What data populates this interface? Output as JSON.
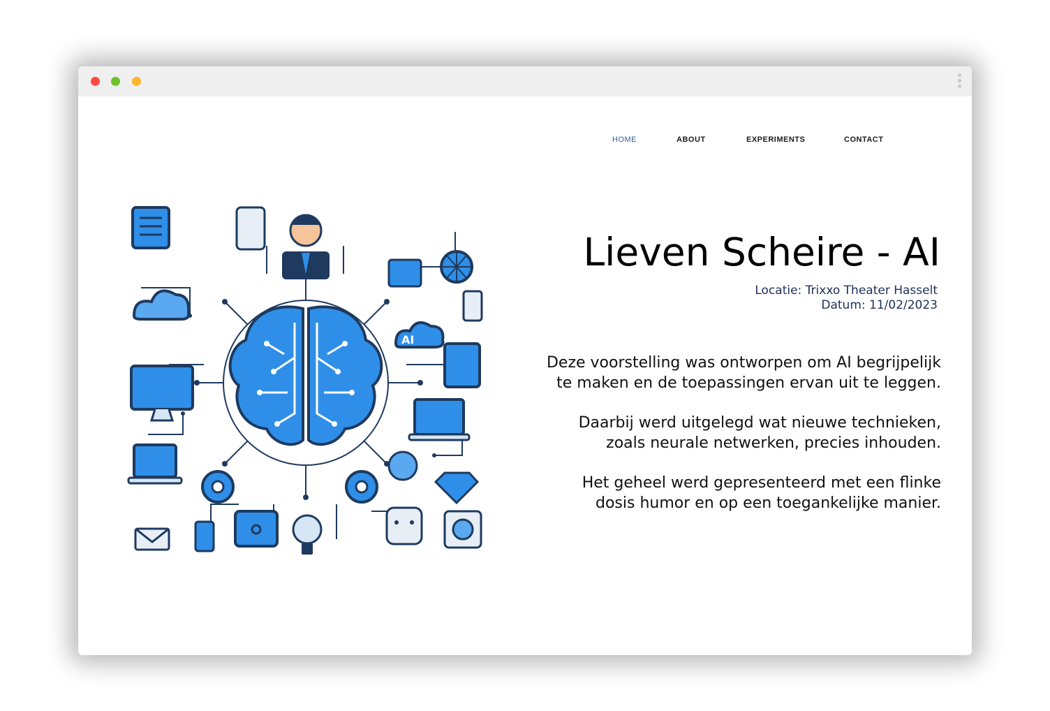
{
  "nav": {
    "items": [
      {
        "label": "HOME",
        "active": true
      },
      {
        "label": "ABOUT",
        "active": false
      },
      {
        "label": "EXPERIMENTS",
        "active": false
      },
      {
        "label": "CONTACT",
        "active": false
      }
    ]
  },
  "hero": {
    "image_icons": [
      "brain-icon",
      "person-icon",
      "laptop-icon",
      "cloud-icon",
      "gear-icon",
      "envelope-icon",
      "diamond-icon",
      "globe-icon",
      "smartphone-icon",
      "robot-icon"
    ],
    "image_badge": "AI"
  },
  "content": {
    "title": "Lieven Scheire - AI",
    "location": "Locatie: Trixxo Theater Hasselt",
    "date": "Datum: 11/02/2023",
    "paragraphs": [
      {
        "line1": "Deze voorstelling was ontworpen om AI begrijpelijk",
        "line2": "te maken en de toepassingen ervan uit te leggen."
      },
      {
        "line1": "Daarbij werd uitgelegd wat nieuwe technieken,",
        "line2": "zoals neurale netwerken, precies inhouden."
      },
      {
        "line1": "Het geheel werd gepresenteerd met een flinke",
        "line2": "dosis humor en op een toegankelijke manier."
      }
    ]
  },
  "colors": {
    "accent": "#2f5e93",
    "icon_blue": "#2f8fe8",
    "icon_dark": "#1e3a5f"
  }
}
